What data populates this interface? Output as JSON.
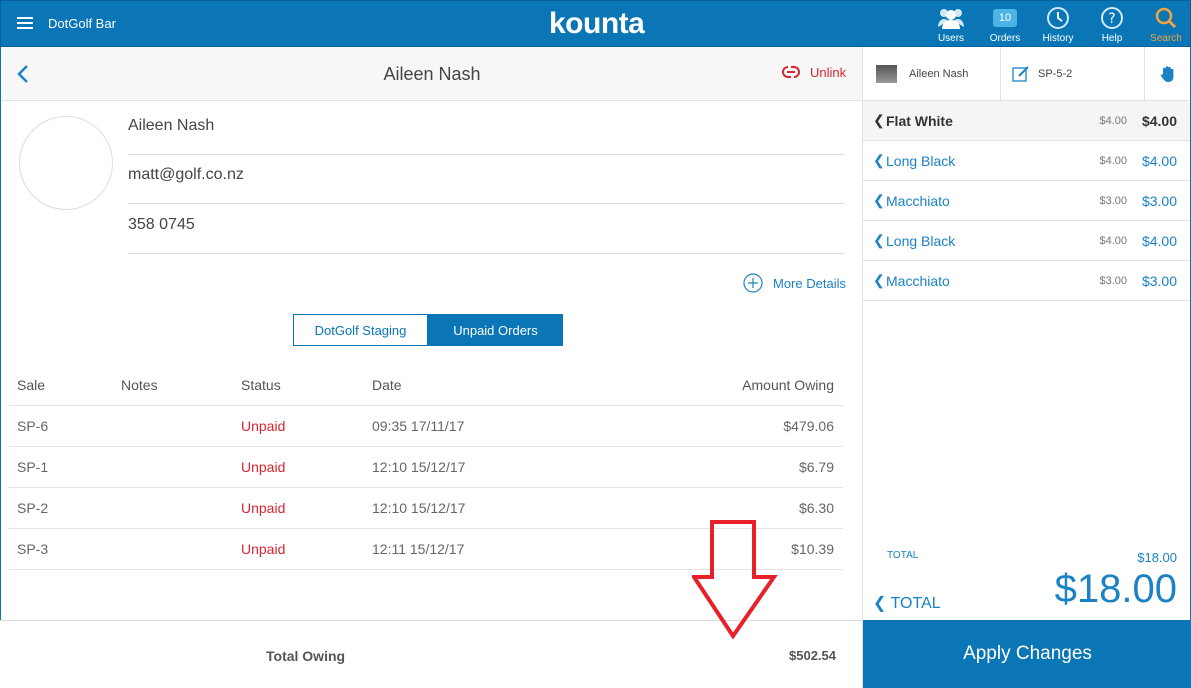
{
  "topbar": {
    "venue": "DotGolf Bar",
    "logo": "kounta",
    "nav": {
      "users": "Users",
      "orders": "Orders",
      "orders_count": "10",
      "history": "History",
      "help": "Help",
      "search": "Search"
    }
  },
  "customer": {
    "title": "Aileen Nash",
    "unlink": "Unlink",
    "name": "Aileen Nash",
    "email": "matt@golf.co.nz",
    "phone": "358 0745",
    "more_details": "More Details"
  },
  "tabs": {
    "staging": "DotGolf Staging",
    "unpaid": "Unpaid Orders"
  },
  "table": {
    "headers": [
      "Sale",
      "Notes",
      "Status",
      "Date",
      "Amount Owing"
    ],
    "rows": [
      {
        "sale": "SP-6",
        "notes": "",
        "status": "Unpaid",
        "date": "09:35 17/11/17",
        "amount": "$479.06"
      },
      {
        "sale": "SP-1",
        "notes": "",
        "status": "Unpaid",
        "date": "12:10 15/12/17",
        "amount": "$6.79"
      },
      {
        "sale": "SP-2",
        "notes": "",
        "status": "Unpaid",
        "date": "12:10 15/12/17",
        "amount": "$6.30"
      },
      {
        "sale": "SP-3",
        "notes": "",
        "status": "Unpaid",
        "date": "12:11 15/12/17",
        "amount": "$10.39"
      }
    ]
  },
  "footer": {
    "total_owing_label": "Total Owing",
    "total_owing_value": "$502.54"
  },
  "order": {
    "customer": "Aileen Nash",
    "sale_id": "SP-5-2",
    "items": [
      {
        "name": "Flat White",
        "unit": "$4.00",
        "price": "$4.00"
      },
      {
        "name": "Long Black",
        "unit": "$4.00",
        "price": "$4.00"
      },
      {
        "name": "Macchiato",
        "unit": "$3.00",
        "price": "$3.00"
      },
      {
        "name": "Long Black",
        "unit": "$4.00",
        "price": "$4.00"
      },
      {
        "name": "Macchiato",
        "unit": "$3.00",
        "price": "$3.00"
      }
    ],
    "subtotal_label": "TOTAL",
    "subtotal_value": "$18.00",
    "total_label": "TOTAL",
    "total_value": "$18.00",
    "apply": "Apply Changes"
  },
  "colors": {
    "brand": "#0a76b6",
    "link": "#1b82c4",
    "alert": "#d7262f",
    "annotation_arrow": "#e8202a"
  },
  "icons": [
    "menu-icon",
    "users-icon",
    "orders-icon",
    "history-icon",
    "help-icon",
    "search-icon",
    "back-chevron-icon",
    "unlink-icon",
    "plus-circle-icon",
    "edit-icon",
    "hand-icon",
    "chevron-left-icon",
    "down-arrow-annotation"
  ]
}
